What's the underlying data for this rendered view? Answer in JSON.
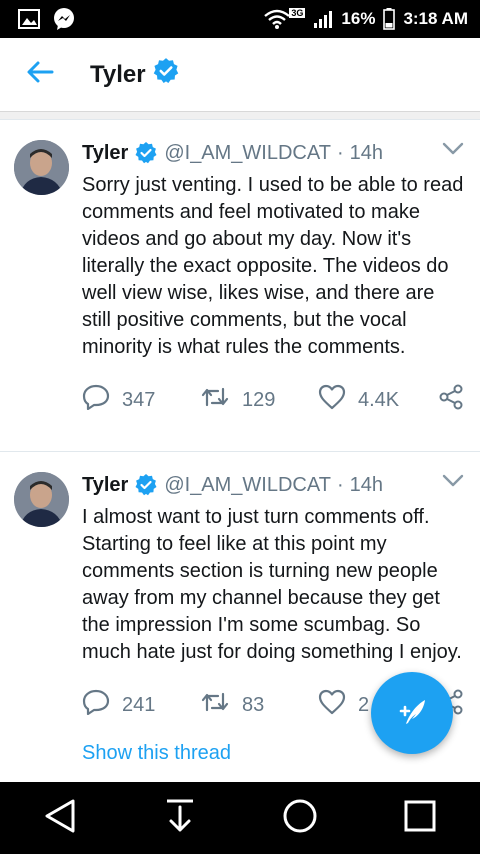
{
  "status_bar": {
    "battery": "16%",
    "time": "3:18 AM",
    "network": "3G",
    "icons": [
      "gallery-icon",
      "messenger-icon",
      "wifi-icon",
      "signal-icon",
      "battery-icon"
    ]
  },
  "header": {
    "title": "Tyler",
    "back_icon": "arrow-left-icon"
  },
  "tweets": [
    {
      "name": "Tyler",
      "handle": "@I_AM_WILDCAT",
      "separator": "·",
      "time": "14h",
      "text": "Sorry just venting. I used to be able to read comments and feel motivated to make videos and go about my day. Now it's literally the exact opposite. The videos do well view wise, likes wise, and there are still positive comments, but the vocal minority is what rules the comments.",
      "replies": "347",
      "retweets": "129",
      "likes": "4.4K"
    },
    {
      "name": "Tyler",
      "handle": "@I_AM_WILDCAT",
      "separator": "·",
      "time": "14h",
      "text": "I almost want to just turn comments off. Starting to feel like at this point my comments section is turning new people away from my channel because they get the impression I'm some scumbag. So much hate just for doing something I enjoy.",
      "replies": "241",
      "retweets": "83",
      "likes": "2",
      "thread_link": "Show this thread"
    }
  ],
  "colors": {
    "accent": "#1da1f2",
    "text": "#14171a",
    "muted": "#657786"
  },
  "nav": [
    "back-triangle-icon",
    "download-arrow-icon",
    "home-circle-icon",
    "recents-square-icon"
  ],
  "fab_icon": "compose-feather-icon"
}
